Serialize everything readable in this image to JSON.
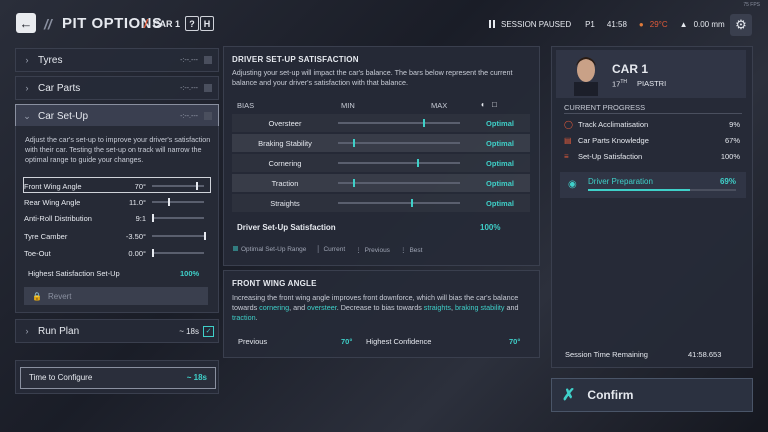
{
  "header": {
    "back_icon": "arrow-left-icon",
    "slashes": "//",
    "title": "PIT OPTIONS",
    "separator": "/",
    "car": "CAR 1",
    "help_key": "?",
    "hotkey": "H",
    "fps": "75 FPS",
    "session_status": "SESSION PAUSED",
    "position": "P1",
    "session_time": "41:58",
    "temperature": "29°C",
    "rainfall": "0.00 mm"
  },
  "menu": {
    "tyres": "Tyres",
    "car_parts": "Car Parts",
    "car_setup": "Car Set-Up",
    "placeholder": "-:--.---",
    "setup_desc": "Adjust the car's set-up to improve your driver's satisfaction with their car. Testing the set-up on track will narrow the optimal range to guide your changes.",
    "params": [
      {
        "name": "Front Wing Angle",
        "value": "70°",
        "level": 0.85
      },
      {
        "name": "Rear Wing Angle",
        "value": "11.0°",
        "level": 0.3
      },
      {
        "name": "Anti-Roll Distribution",
        "value": "9:1",
        "level": 0.0
      },
      {
        "name": "Tyre Camber",
        "value": "-3.50°",
        "level": 1.0
      },
      {
        "name": "Toe-Out",
        "value": "0.00°",
        "level": 0.0
      }
    ],
    "highest_label": "Highest Satisfaction Set-Up",
    "highest_value": "100%",
    "revert": "Revert",
    "run_plan": "Run Plan",
    "run_plan_time": "~ 18s",
    "time_to_configure": "Time to Configure",
    "time_to_configure_value": "~ 18s"
  },
  "satisfaction": {
    "title": "DRIVER SET-UP SATISFACTION",
    "desc": "Adjusting your set-up will impact the car's balance. The bars below represent the current balance and your driver's satisfaction with that balance.",
    "col_bias": "BIAS",
    "col_min": "MIN",
    "col_max": "MAX",
    "rows": [
      {
        "name": "Oversteer",
        "status": "Optimal",
        "level": 0.7
      },
      {
        "name": "Braking Stability",
        "status": "Optimal",
        "level": 0.12
      },
      {
        "name": "Cornering",
        "status": "Optimal",
        "level": 0.65
      },
      {
        "name": "Traction",
        "status": "Optimal",
        "level": 0.12
      },
      {
        "name": "Straights",
        "status": "Optimal",
        "level": 0.6
      }
    ],
    "total_label": "Driver Set-Up Satisfaction",
    "total_value": "100%",
    "legend": [
      "Optimal Set-Up Range",
      "Current",
      "Previous",
      "Best"
    ]
  },
  "front_wing": {
    "title": "FRONT WING ANGLE",
    "desc_1": "Increasing the front wing angle improves front downforce, which will bias the car's balance towards ",
    "cornering": "cornering",
    "desc_2": ", and ",
    "oversteer": "oversteer",
    "desc_3": ". Decrease to bias towards ",
    "straights": "straights",
    "desc_4": ", ",
    "braking_stability": "braking stability",
    "desc_5": " and ",
    "traction": "traction",
    "desc_6": ".",
    "previous_label": "Previous",
    "previous_value": "70°",
    "highest_label": "Highest Confidence",
    "highest_value": "70°"
  },
  "driver": {
    "car": "CAR 1",
    "position": "17",
    "position_suffix": "TH",
    "name": "PIASTRI",
    "progress_title": "CURRENT PROGRESS",
    "progress": [
      {
        "label": "Track Acclimatisation",
        "value": "9%",
        "icon": "steering-icon"
      },
      {
        "label": "Car Parts Knowledge",
        "value": "67%",
        "icon": "car-icon"
      },
      {
        "label": "Set-Up Satisfaction",
        "value": "100%",
        "icon": "sliders-icon"
      }
    ],
    "prep_label": "Driver Preparation",
    "prep_value": "69%",
    "prep_level": 0.69,
    "remaining_label": "Session Time Remaining",
    "remaining_value": "41:58.653"
  },
  "confirm": "Confirm",
  "colors": {
    "accent": "#3fd0c9",
    "alert": "#e05a3a"
  }
}
